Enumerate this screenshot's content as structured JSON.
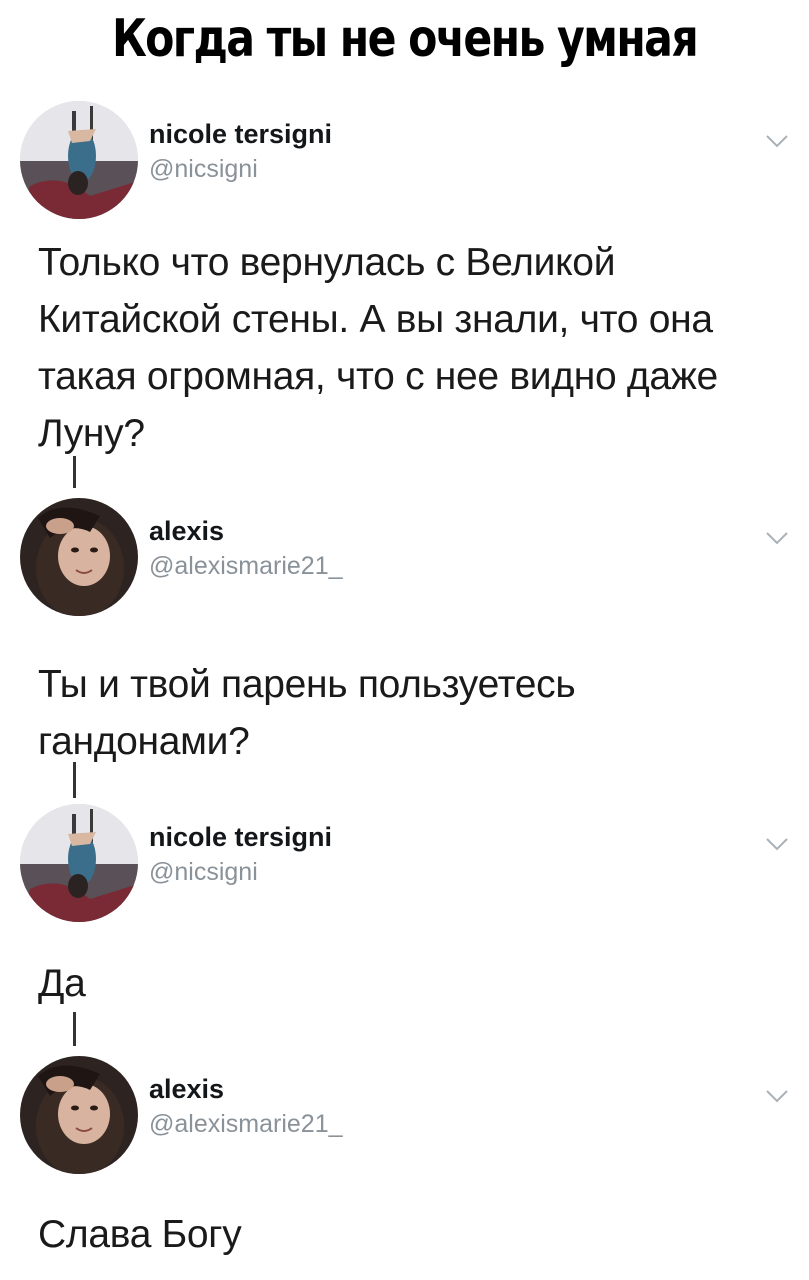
{
  "meme": {
    "title": "Когда ты не очень умная"
  },
  "thread": [
    {
      "name": "nicole tersigni",
      "handle": "@nicsigni",
      "text": "Только что вернулась с Великой Китайской стены. А вы знали, что она такая огромная, что с нее видно даже Луну?"
    },
    {
      "name": "alexis",
      "handle": "@alexismarie21_",
      "text": "Ты и твой парень пользуетесь гандонами?"
    },
    {
      "name": "nicole tersigni",
      "handle": "@nicsigni",
      "text": "Да"
    },
    {
      "name": "alexis",
      "handle": "@alexismarie21_",
      "text": "Слава Богу"
    }
  ],
  "icons": {
    "menu_chevron": "chevron-down-icon",
    "avatar": "profile-photo"
  },
  "colors": {
    "name_text": "#14171a",
    "handle_text": "#8a9299",
    "thread_line": "#333333"
  }
}
